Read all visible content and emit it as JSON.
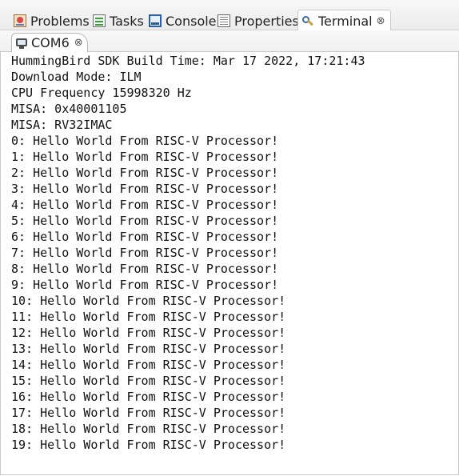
{
  "view_tabs": [
    {
      "label": "Problems",
      "icon": "problems-icon",
      "active": false
    },
    {
      "label": "Tasks",
      "icon": "tasks-icon",
      "active": false
    },
    {
      "label": "Console",
      "icon": "console-icon",
      "active": false
    },
    {
      "label": "Properties",
      "icon": "properties-icon",
      "active": false
    },
    {
      "label": "Terminal",
      "icon": "terminal-icon",
      "active": true,
      "close": "⊗"
    }
  ],
  "terminal_tab": {
    "label": "COM6",
    "icon": "serial-port-icon",
    "close": "⊗"
  },
  "output_lines": [
    "HummingBird SDK Build Time: Mar 17 2022, 17:21:43",
    "Download Mode: ILM",
    "CPU Frequency 15998320 Hz",
    "MISA: 0x40001105",
    "MISA: RV32IMAC",
    "0: Hello World From RISC-V Processor!",
    "1: Hello World From RISC-V Processor!",
    "2: Hello World From RISC-V Processor!",
    "3: Hello World From RISC-V Processor!",
    "4: Hello World From RISC-V Processor!",
    "5: Hello World From RISC-V Processor!",
    "6: Hello World From RISC-V Processor!",
    "7: Hello World From RISC-V Processor!",
    "8: Hello World From RISC-V Processor!",
    "9: Hello World From RISC-V Processor!",
    "10: Hello World From RISC-V Processor!",
    "11: Hello World From RISC-V Processor!",
    "12: Hello World From RISC-V Processor!",
    "13: Hello World From RISC-V Processor!",
    "14: Hello World From RISC-V Processor!",
    "15: Hello World From RISC-V Processor!",
    "16: Hello World From RISC-V Processor!",
    "17: Hello World From RISC-V Processor!",
    "18: Hello World From RISC-V Processor!",
    "19: Hello World From RISC-V Processor!"
  ]
}
